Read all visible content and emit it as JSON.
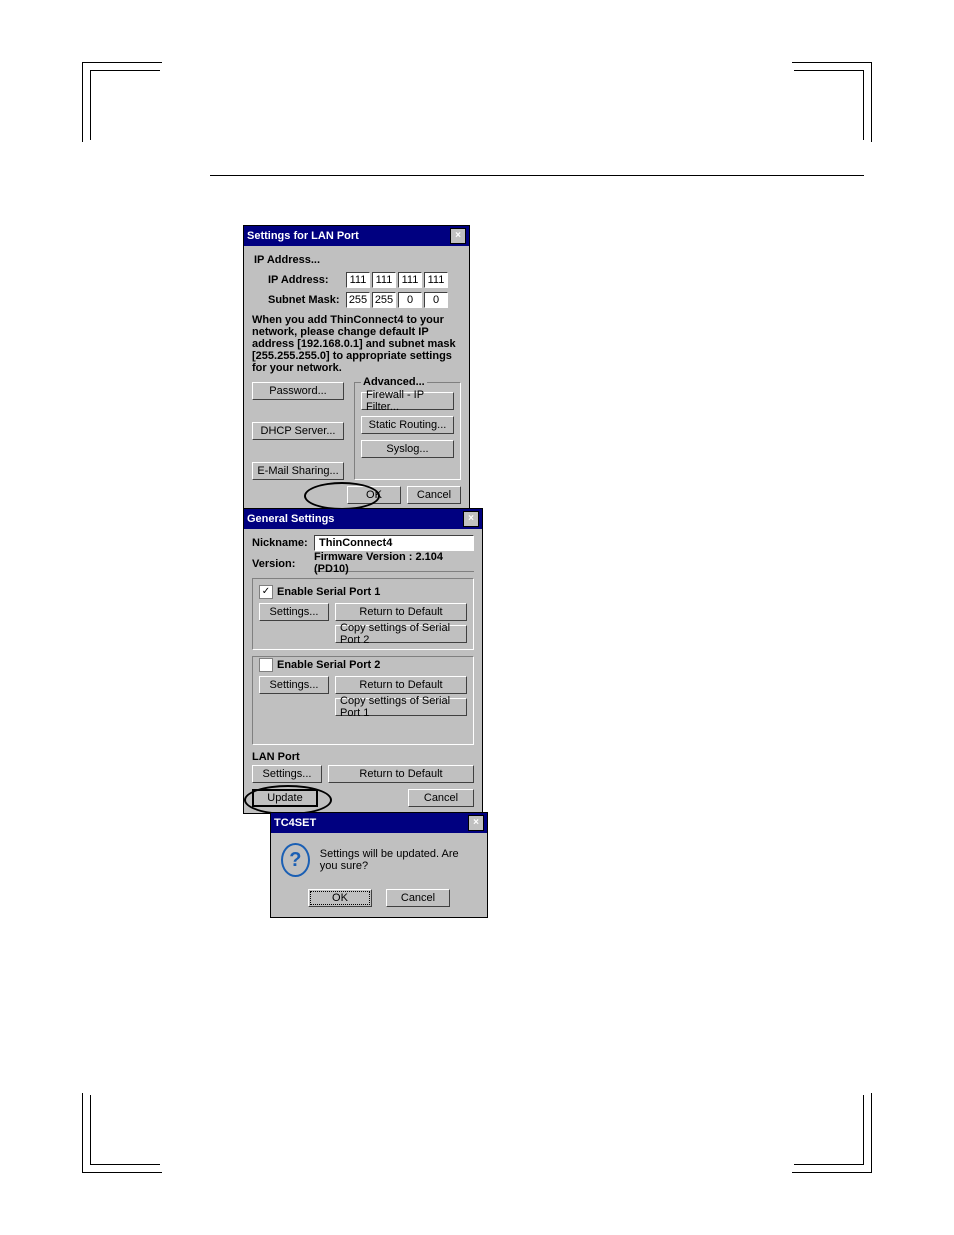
{
  "dlg1": {
    "title": "Settings for LAN Port",
    "ipGroup": "IP Address...",
    "ipLabel": "IP Address:",
    "ip": [
      "111",
      "111",
      "111",
      "111"
    ],
    "maskLabel": "Subnet Mask:",
    "mask": [
      "255",
      "255",
      "0",
      "0"
    ],
    "note": "When you add ThinConnect4 to your network, please change default IP address [192.168.0.1] and subnet mask [255.255.255.0] to appropriate settings for your network.",
    "advanced": "Advanced...",
    "password": "Password...",
    "firewall": "Firewall - IP Filter...",
    "staticRouting": "Static Routing...",
    "dhcp": "DHCP Server...",
    "syslog": "Syslog...",
    "email": "E-Mail Sharing...",
    "ok": "OK",
    "cancel": "Cancel"
  },
  "dlg2": {
    "title": "General Settings",
    "nicknameLabel": "Nickname:",
    "nickname": "ThinConnect4",
    "versionLabel": "Version:",
    "version": "Firmware Version : 2.104  (PD10)",
    "sp1Label": "Enable Serial Port 1",
    "sp2Label": "Enable Serial Port 2",
    "settings": "Settings...",
    "rtd": "Return to Default",
    "copy2": "Copy settings of Serial Port 2",
    "copy1": "Copy settings of Serial Port 1",
    "lanPort": "LAN Port",
    "update": "Update",
    "cancel": "Cancel"
  },
  "dlg3": {
    "title": "TC4SET",
    "msg": "Settings will be updated. Are you sure?",
    "ok": "OK",
    "cancel": "Cancel"
  }
}
